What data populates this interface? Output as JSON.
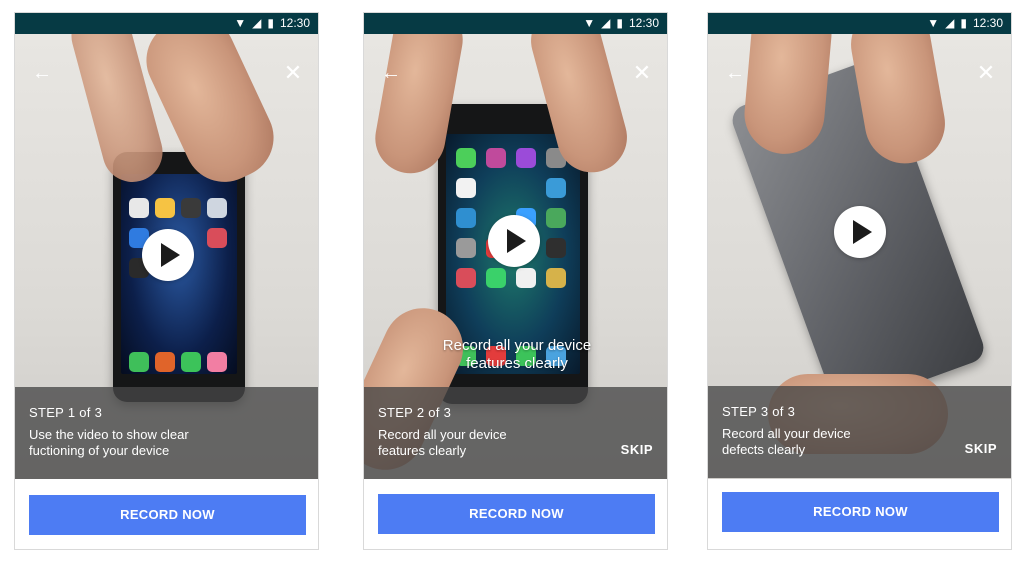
{
  "status_bar": {
    "time": "12:30"
  },
  "accent_color": "#4d7cf3",
  "screens": [
    {
      "step_label": "STEP 1 of 3",
      "description_line1": "Use the video to show clear",
      "description_line2": "fuctioning of your device",
      "record_label": "RECORD NOW"
    },
    {
      "step_label": "STEP 2 of 3",
      "description_line1": "Record all your device",
      "description_line2": "features clearly",
      "overlay_line1": "Record all your device",
      "overlay_line2": "features clearly",
      "skip_label": "SKIP",
      "record_label": "RECORD NOW"
    },
    {
      "step_label": "STEP 3 of 3",
      "description_line1": "Record all your device",
      "description_line2": "defects clearly",
      "skip_label": "SKIP",
      "record_label": "RECORD NOW"
    }
  ]
}
